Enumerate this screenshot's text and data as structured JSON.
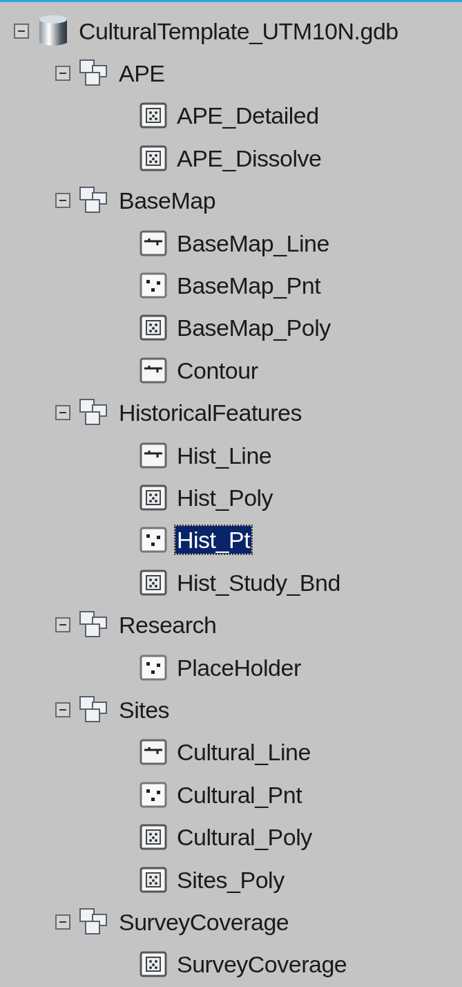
{
  "tree": [
    {
      "label": "CulturalTemplate_UTM10N.gdb",
      "kind": "database",
      "expanded": true,
      "children": [
        {
          "label": "APE",
          "kind": "dataset",
          "expanded": true,
          "children": [
            {
              "label": "APE_Detailed",
              "kind": "polygon",
              "selected": false
            },
            {
              "label": "APE_Dissolve",
              "kind": "polygon",
              "selected": false
            }
          ]
        },
        {
          "label": "BaseMap",
          "kind": "dataset",
          "expanded": true,
          "children": [
            {
              "label": "BaseMap_Line",
              "kind": "line",
              "selected": false
            },
            {
              "label": "BaseMap_Pnt",
              "kind": "point",
              "selected": false
            },
            {
              "label": "BaseMap_Poly",
              "kind": "polygon",
              "selected": false
            },
            {
              "label": "Contour",
              "kind": "line",
              "selected": false
            }
          ]
        },
        {
          "label": "HistoricalFeatures",
          "kind": "dataset",
          "expanded": true,
          "children": [
            {
              "label": "Hist_Line",
              "kind": "line",
              "selected": false
            },
            {
              "label": "Hist_Poly",
              "kind": "polygon",
              "selected": false
            },
            {
              "label": "Hist_Pt",
              "kind": "point",
              "selected": true
            },
            {
              "label": "Hist_Study_Bnd",
              "kind": "polygon",
              "selected": false
            }
          ]
        },
        {
          "label": "Research",
          "kind": "dataset",
          "expanded": true,
          "children": [
            {
              "label": "PlaceHolder",
              "kind": "point",
              "selected": false
            }
          ]
        },
        {
          "label": "Sites",
          "kind": "dataset",
          "expanded": true,
          "children": [
            {
              "label": "Cultural_Line",
              "kind": "line",
              "selected": false
            },
            {
              "label": "Cultural_Pnt",
              "kind": "point",
              "selected": false
            },
            {
              "label": "Cultural_Poly",
              "kind": "polygon",
              "selected": false
            },
            {
              "label": "Sites_Poly",
              "kind": "polygon",
              "selected": false
            }
          ]
        },
        {
          "label": "SurveyCoverage",
          "kind": "dataset",
          "expanded": true,
          "children": [
            {
              "label": "SurveyCoverage",
              "kind": "polygon",
              "selected": false
            }
          ]
        }
      ]
    }
  ]
}
